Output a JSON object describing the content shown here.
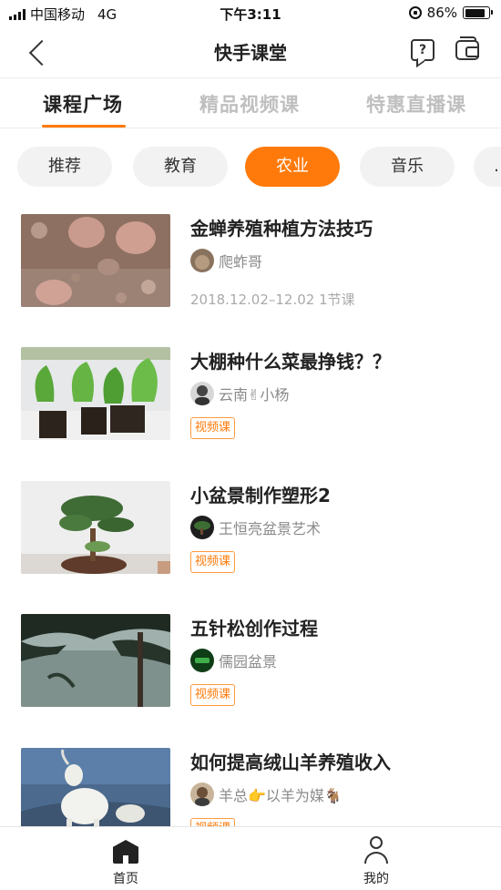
{
  "status_bar": {
    "carrier": "中国移动",
    "network": "4G",
    "time": "下午3:11",
    "battery": "86%",
    "battery_level": 0.86
  },
  "nav": {
    "title": "快手课堂",
    "back_icon": "back-arrow-icon",
    "help_icon": "help-question-icon",
    "wallet_icon": "wallet-icon"
  },
  "main_tabs": [
    {
      "label": "课程广场",
      "active": true
    },
    {
      "label": "精品视频课",
      "active": false
    },
    {
      "label": "特惠直播课",
      "active": false
    }
  ],
  "categories": [
    {
      "label": "推荐",
      "active": false
    },
    {
      "label": "教育",
      "active": false
    },
    {
      "label": "农业",
      "active": true
    },
    {
      "label": "音乐",
      "active": false
    },
    {
      "label": "…",
      "active": false
    }
  ],
  "courses": [
    {
      "title": "金蝉养殖种植方法技巧",
      "author": "爬蚱哥",
      "meta": "2018.12.02–12.02 1节课",
      "badge": ""
    },
    {
      "title": "大棚种什么菜最挣钱？？",
      "author": "云南✌小杨",
      "meta": "",
      "badge": "视频课"
    },
    {
      "title": "小盆景制作塑形2",
      "author": "王恒亮盆景艺术",
      "meta": "",
      "badge": "视频课"
    },
    {
      "title": "五针松创作过程",
      "author": "儒园盆景",
      "meta": "",
      "badge": "视频课"
    },
    {
      "title": "如何提高绒山羊养殖收入",
      "author": "羊总👉以羊为媒🐐",
      "meta": "",
      "badge": "视频课"
    }
  ],
  "tab_bar": {
    "home_label": "首页",
    "mine_label": "我的"
  },
  "colors": {
    "accent": "#ff7a0a",
    "chip_bg": "#f2f2f2",
    "inactive_tab": "#bfbfbf"
  }
}
